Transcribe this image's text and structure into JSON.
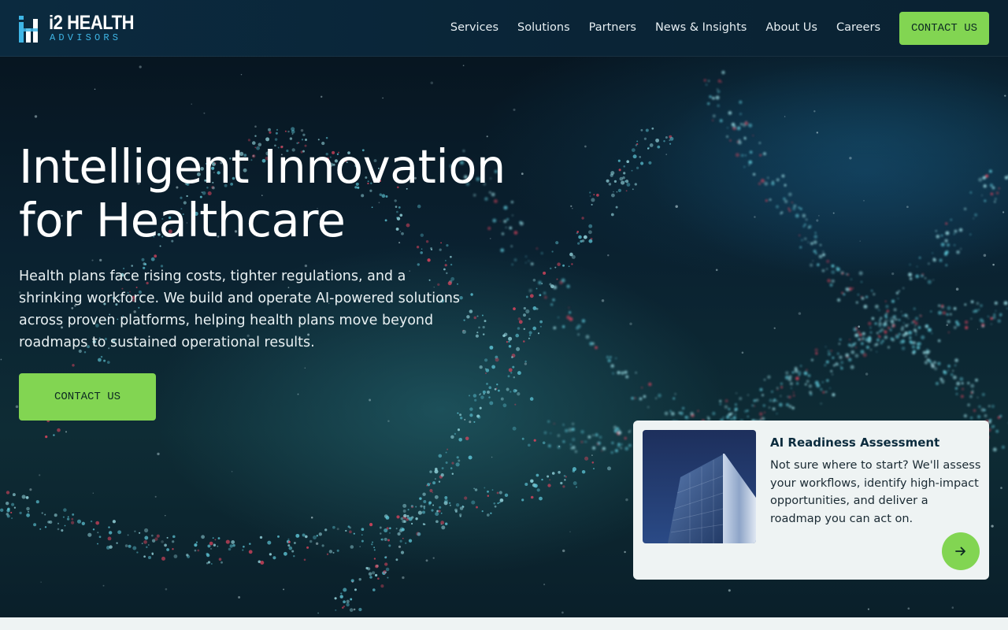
{
  "brand": {
    "name": "i2 HEALTH",
    "tagline": "ADVISORS",
    "accent": "#82d552",
    "logo_blue": "#3fb6e6"
  },
  "nav": {
    "links": [
      "Services",
      "Solutions",
      "Partners",
      "News & Insights",
      "About Us",
      "Careers"
    ],
    "cta_label": "CONTACT US"
  },
  "hero": {
    "title_line1": "Intelligent Innovation",
    "title_line2": "for Healthcare",
    "body": "Health plans face rising costs, tighter regulations, and a shrinking workforce. We build and operate AI-powered solutions across proven platforms, helping health plans move beyond roadmaps to sustained operational results.",
    "cta_label": "CONTACT US"
  },
  "card": {
    "title": "AI Readiness Assessment",
    "body": "Not sure where to start? We'll assess your workflows, identify high-impact opportunities, and deliver a roadmap you can act on.",
    "arrow_icon": "arrow-right-icon"
  }
}
